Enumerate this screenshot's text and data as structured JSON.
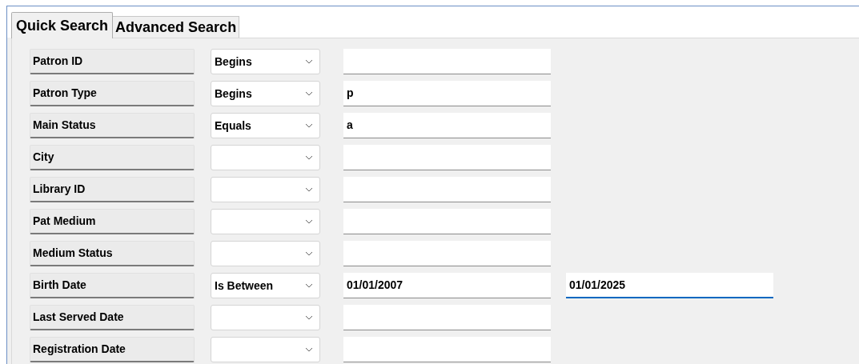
{
  "tabs": [
    {
      "label": "Quick Search",
      "selected": true
    },
    {
      "label": "Advanced Search",
      "selected": false
    }
  ],
  "criteria": [
    {
      "label": "Patron ID",
      "operator": "Begins"
    },
    {
      "label": "Patron Type",
      "operator": "Begins",
      "value": "p"
    },
    {
      "label": "Main Status",
      "operator": "Equals",
      "value": "a"
    },
    {
      "label": "City"
    },
    {
      "label": "Library ID"
    },
    {
      "label": "Pat Medium"
    },
    {
      "label": "Medium Status"
    },
    {
      "label": "Birth Date",
      "operator": "Is Between",
      "value": "01/01/2007",
      "end_value": {
        "value": "01/01/2025",
        "focused": true
      }
    },
    {
      "label": "Last Served Date"
    },
    {
      "label": "Registration Date"
    }
  ]
}
